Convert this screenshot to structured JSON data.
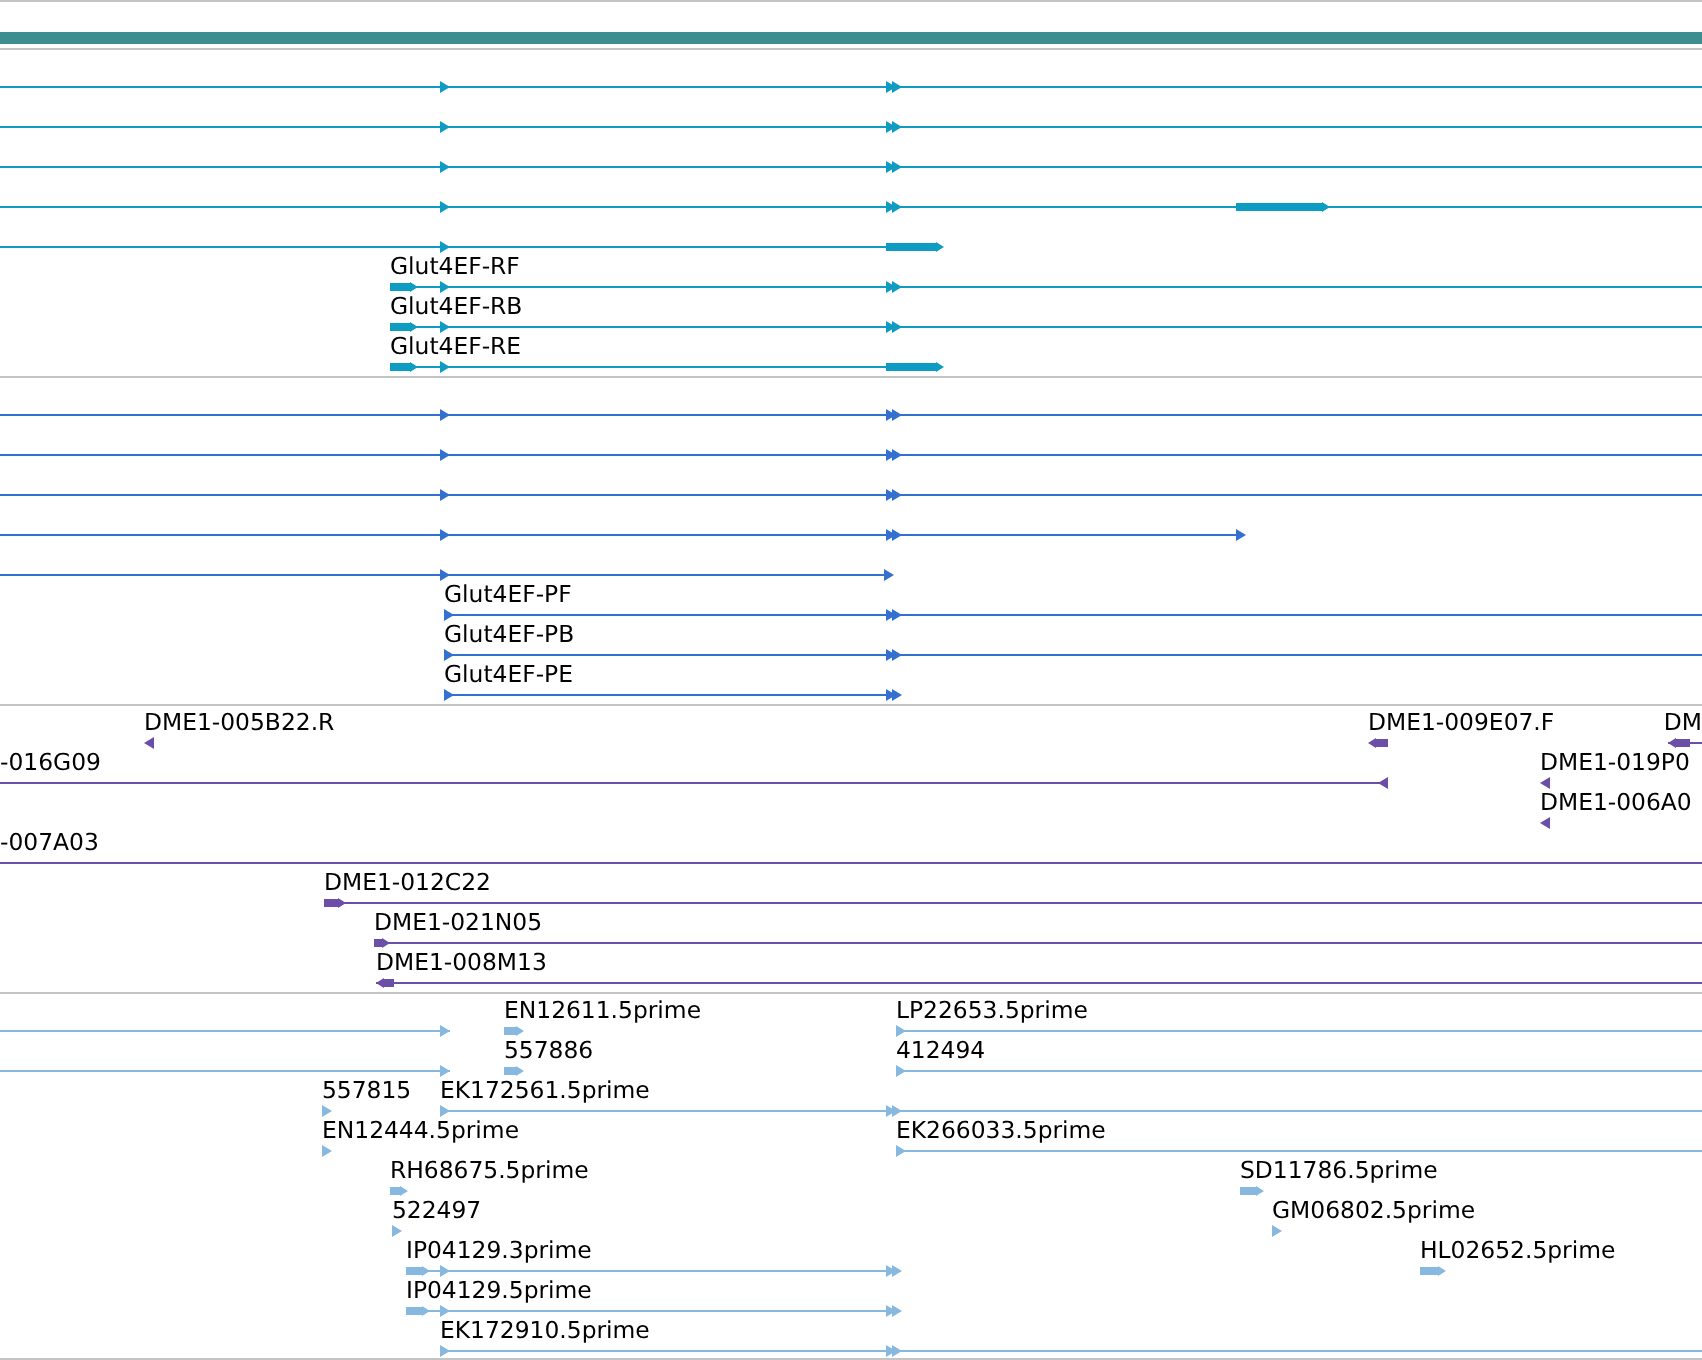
{
  "tracks": [
    {
      "color": "#0e9cc2",
      "features": [
        {
          "reverse": false
        },
        {
          "reverse": false
        },
        {
          "reverse": false
        },
        {
          "reverse": false
        },
        {
          "reverse": false
        },
        {
          "label": "Glut4EF-RF",
          "reverse": false
        },
        {
          "label": "Glut4EF-RB",
          "reverse": false
        },
        {
          "label": "Glut4EF-RE",
          "reverse": false
        }
      ]
    },
    {
      "color": "#3370d0",
      "features": [
        {
          "reverse": false
        },
        {
          "reverse": false
        },
        {
          "reverse": false
        },
        {
          "reverse": false
        },
        {
          "reverse": false
        },
        {
          "label": "Glut4EF-PF",
          "reverse": false
        },
        {
          "label": "Glut4EF-PB",
          "reverse": false
        },
        {
          "label": "Glut4EF-PE",
          "reverse": false
        }
      ]
    },
    {
      "color": "#6a4ea8",
      "features": [
        {
          "label": "DME1-005B22.R",
          "reverse": true
        },
        {
          "label": "DME1-009E07.F",
          "reverse": true
        },
        {
          "label": "DM",
          "reverse": true
        },
        {
          "label": "-016G09",
          "reverse": true
        },
        {
          "label": "DME1-019P0",
          "reverse": true
        },
        {
          "label": "DME1-006A0",
          "reverse": true
        },
        {
          "label": "-007A03"
        },
        {
          "label": "DME1-012C22",
          "reverse": false
        },
        {
          "label": "DME1-021N05",
          "reverse": false
        },
        {
          "label": "DME1-008M13",
          "reverse": true
        }
      ]
    },
    {
      "color": "#86b8e0",
      "features": [
        {
          "reverse": false
        },
        {
          "label": "EN12611.5prime",
          "reverse": false
        },
        {
          "label": "LP22653.5prime",
          "reverse": false
        },
        {
          "reverse": false
        },
        {
          "label": "557886",
          "reverse": false
        },
        {
          "label": "412494",
          "reverse": false
        },
        {
          "label": "557815",
          "reverse": false
        },
        {
          "label": "EK172561.5prime",
          "reverse": false
        },
        {
          "label": "EN12444.5prime",
          "reverse": false
        },
        {
          "label": "EK266033.5prime",
          "reverse": false
        },
        {
          "label": "RH68675.5prime",
          "reverse": false
        },
        {
          "label": "SD11786.5prime",
          "reverse": false
        },
        {
          "label": "522497",
          "reverse": false
        },
        {
          "label": "GM06802.5prime",
          "reverse": false
        },
        {
          "label": "IP04129.3prime",
          "reverse": false
        },
        {
          "label": "HL02652.5prime",
          "reverse": false
        },
        {
          "label": "IP04129.5prime",
          "reverse": false
        },
        {
          "label": "EK172910.5prime",
          "reverse": false
        }
      ]
    }
  ]
}
